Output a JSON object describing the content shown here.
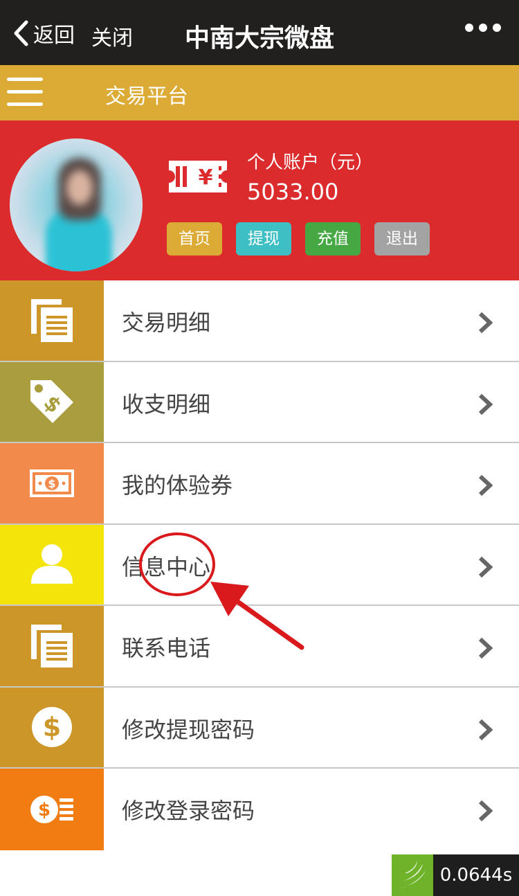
{
  "navbar": {
    "back_label": "返回",
    "close_label": "关闭",
    "title": "中南大宗微盘"
  },
  "appbar": {
    "title": "交易平台"
  },
  "account": {
    "label": "个人账户（元）",
    "balance": "5033.00",
    "buttons": [
      {
        "label": "首页",
        "color": "#dcab36"
      },
      {
        "label": "提现",
        "color": "#3dbfc3"
      },
      {
        "label": "充值",
        "color": "#46a843"
      },
      {
        "label": "退出",
        "color": "#a3a3a3"
      }
    ]
  },
  "menu": [
    {
      "label": "交易明细",
      "icon": "document-stack-icon",
      "color": "#cd9629"
    },
    {
      "label": "收支明细",
      "icon": "price-tag-icon",
      "color": "#a99d3d"
    },
    {
      "label": "我的体验券",
      "icon": "banknote-icon",
      "color": "#f28a4b"
    },
    {
      "label": "信息中心",
      "icon": "user-icon",
      "color": "#f5e40a"
    },
    {
      "label": "联系电话",
      "icon": "document-stack-icon",
      "color": "#cd9629"
    },
    {
      "label": "修改提现密码",
      "icon": "dollar-coin-icon",
      "color": "#cd9629"
    },
    {
      "label": "修改登录密码",
      "icon": "coin-stack-icon",
      "color": "#f07c12"
    }
  ],
  "timer": {
    "value": "0.0644s"
  }
}
